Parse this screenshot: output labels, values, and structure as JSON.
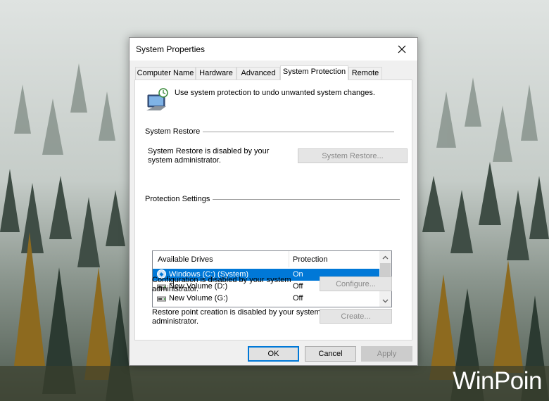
{
  "window": {
    "title": "System Properties"
  },
  "tabs": [
    {
      "label": "Computer Name"
    },
    {
      "label": "Hardware"
    },
    {
      "label": "Advanced"
    },
    {
      "label": "System Protection",
      "active": true
    },
    {
      "label": "Remote"
    }
  ],
  "header": {
    "icon": "system-protection-monitor-icon",
    "text": "Use system protection to undo unwanted system changes."
  },
  "system_restore": {
    "group_label": "System Restore",
    "description": "System Restore is disabled by your system administrator.",
    "button_label": "System Restore...",
    "button_enabled": false
  },
  "protection_settings": {
    "group_label": "Protection Settings",
    "columns": [
      "Available Drives",
      "Protection"
    ],
    "drives": [
      {
        "name": "Windows (C:) (System)",
        "protection": "On",
        "icon": "system-drive-icon",
        "selected": true
      },
      {
        "name": "New Volume (D:)",
        "protection": "Off",
        "icon": "drive-icon",
        "selected": false
      },
      {
        "name": "New Volume (G:)",
        "protection": "Off",
        "icon": "drive-icon",
        "selected": false
      }
    ],
    "configure": {
      "description": "Configuration is disabled by your system administrator.",
      "button_label": "Configure...",
      "button_enabled": false
    },
    "create": {
      "description": "Restore point creation is disabled by your system administrator.",
      "button_label": "Create...",
      "button_enabled": false
    }
  },
  "footer": {
    "ok": "OK",
    "cancel": "Cancel",
    "apply": "Apply"
  },
  "watermark": "WinPoin",
  "colors": {
    "selection": "#0078d7",
    "dialog_bg": "#f0f0f0",
    "disabled_text": "#8a8a8a"
  }
}
